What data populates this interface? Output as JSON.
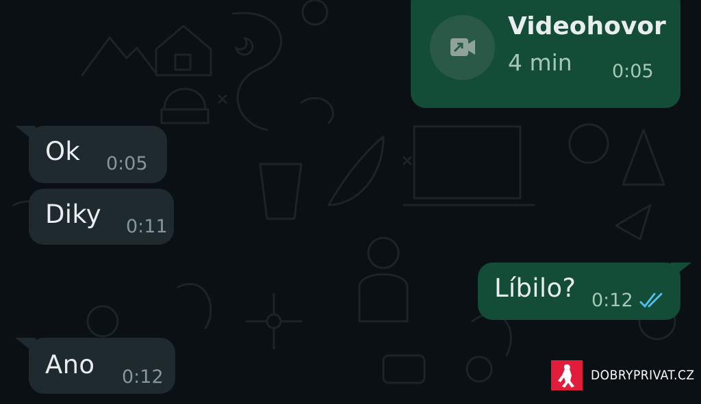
{
  "call": {
    "title": "Videohovor",
    "duration": "4 min",
    "time": "0:05",
    "icon": "video-call-icon"
  },
  "messages": [
    {
      "direction": "incoming",
      "text": "Ok",
      "time": "0:05"
    },
    {
      "direction": "incoming",
      "text": "Diky",
      "time": "0:11"
    },
    {
      "direction": "outgoing",
      "text": "Líbilo?",
      "time": "0:12",
      "status": "read-double-check"
    },
    {
      "direction": "incoming",
      "text": "Ano",
      "time": "0:12"
    }
  ],
  "watermark": {
    "text": "DOBRYPRIVAT.CZ"
  },
  "colors": {
    "background": "#0b1014",
    "incoming_bubble": "#1f2a2f",
    "outgoing_bubble": "#144d37",
    "read_check": "#53bdeb"
  }
}
